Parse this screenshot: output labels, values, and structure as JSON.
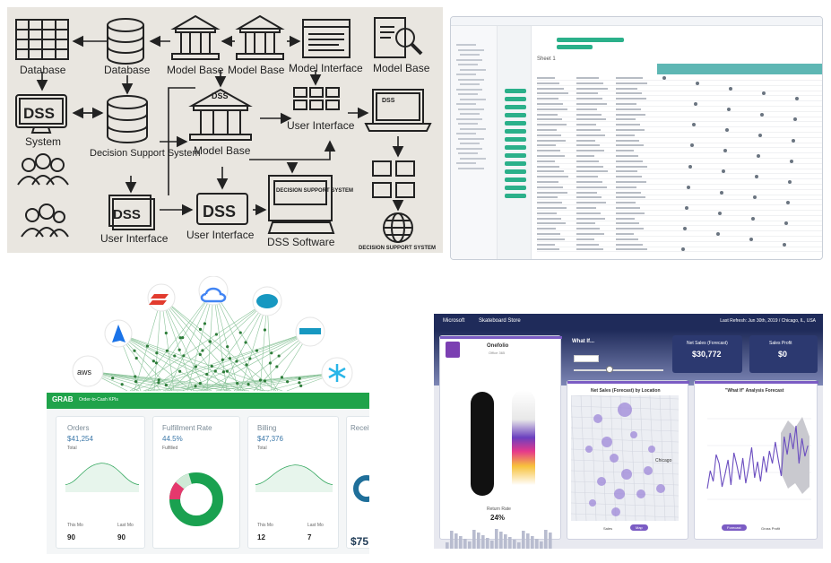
{
  "dss_diagram": {
    "labels": {
      "database_1": "Database",
      "database_2": "Database",
      "model_base_1": "Model Base",
      "model_base_2": "Model Base",
      "model_interface": "Model Interface",
      "model_base_3": "Model Base",
      "dss_system_box": "DSS",
      "system": "System",
      "decision_support_system": "Decision Support System",
      "dss_center": "DSS",
      "model_base_center": "Model Base",
      "dss_laptop": "DSS",
      "user_interface_1": "User Interface",
      "dss_small": "DSS",
      "dss_middle": "DSS",
      "user_interface_2": "User Interface",
      "user_interface_3": "User Interface",
      "monitor_text": "DECISION SUPPORT SYSTEM",
      "dss_software": "DSS Software",
      "decision_support_system_caption": "DECISION SUPPORT SYSTEM"
    }
  },
  "spreadsheet": {
    "title": "Sheet 1",
    "tag_color": "#2bb08a"
  },
  "integration_dashboard": {
    "logos": [
      "aws",
      "Azure",
      "Google Cloud",
      "Salesforce",
      "Snowflake"
    ],
    "header_logo": "GRAB",
    "header_title": "Order-to-Cash KPIs",
    "header_color": "#1fa34a",
    "cards": [
      {
        "title": "Orders",
        "value": "$41,254",
        "sub": "Total",
        "left_label": "This Mo",
        "left_value": "90",
        "right_label": "Last Mo",
        "right_value": "90"
      },
      {
        "title": "Fulfillment Rate",
        "value": "44.5%",
        "sub": "Fulfilled"
      },
      {
        "title": "Billing",
        "value": "$47,376",
        "sub": "Total",
        "left_label": "This Mo",
        "left_value": "12",
        "right_label": "Last Mo",
        "right_value": "7"
      },
      {
        "title": "Receiv",
        "value": "$75"
      }
    ]
  },
  "skateboard_dashboard": {
    "header_brand": "Microsoft",
    "header_title": "Skateboard Store",
    "last_refresh": "Last Refresh: Jun 30th, 2019 / Chicago, IL, USA",
    "product_name": "Onefolio",
    "product_sub": "Office 365",
    "return_rate_label": "Return Rate",
    "return_rate_value": "24%",
    "what_if_title": "What If...",
    "net_sales_title": "Net Sales (Forecast)",
    "net_sales_value": "$30,772",
    "sales_profit_title": "Sales Profit",
    "sales_profit_value": "$0",
    "map_title": "Net Sales (Forecast) by Location",
    "map_city": "Chicago",
    "forecast_title": "\"What If\" Analysis Forecast",
    "map_btn_1": "Sales",
    "map_btn_2": "Map",
    "chart_btn_1": "Forecast",
    "chart_btn_2": "Gross Profit",
    "accent": "#7b5cc4"
  }
}
